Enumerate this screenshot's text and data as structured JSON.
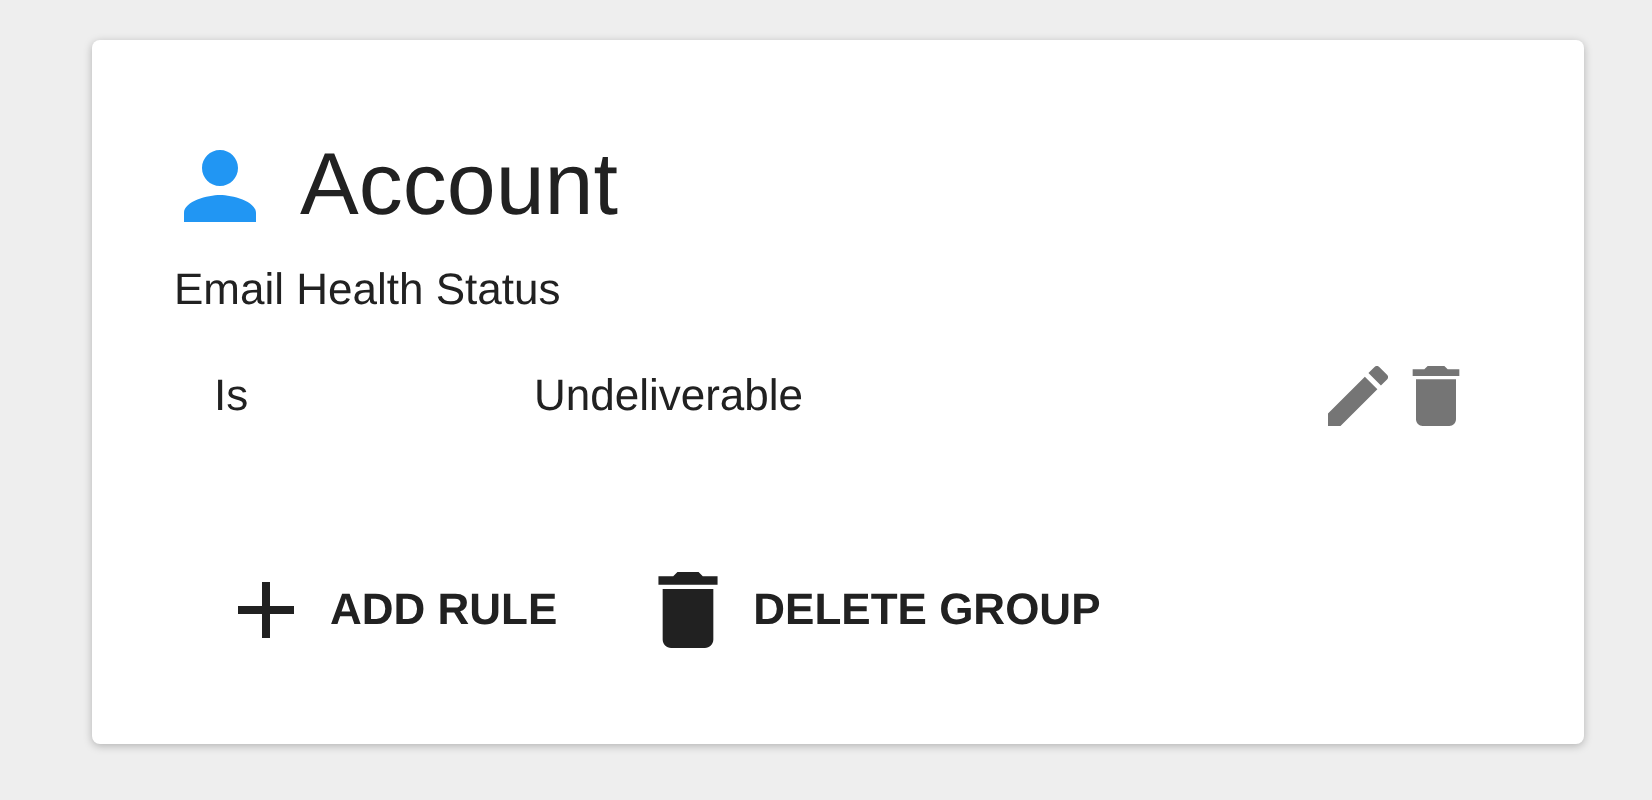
{
  "card": {
    "title": "Account",
    "field": "Email Health Status",
    "rules": [
      {
        "operator": "Is",
        "value": "Undeliverable"
      }
    ],
    "actions": [
      {
        "kind": "add",
        "label": "ADD RULE"
      },
      {
        "kind": "delete",
        "label": "DELETE GROUP"
      }
    ]
  }
}
